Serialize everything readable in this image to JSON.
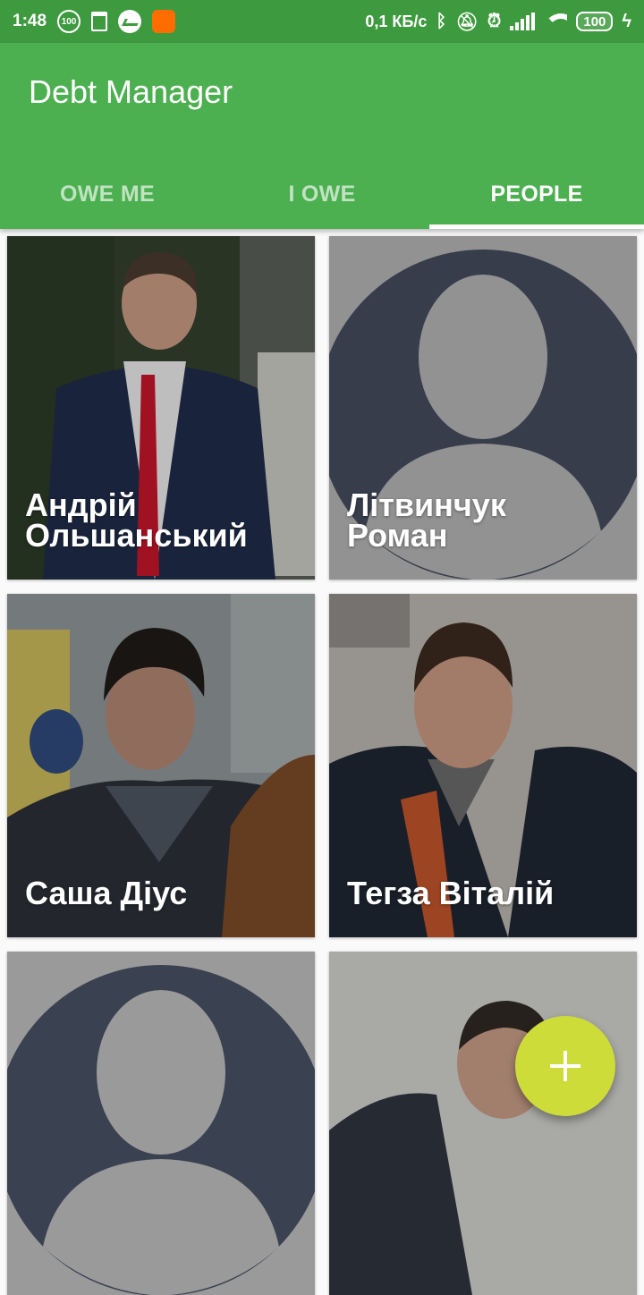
{
  "status_bar": {
    "time": "1:48",
    "notif_badge": "100",
    "network_speed": "0,1 КБ/с",
    "battery": "100",
    "icons": [
      "notification-100-icon",
      "trash-icon",
      "messenger-icon",
      "app-icon",
      "bluetooth-icon",
      "mute-icon",
      "alarm-icon",
      "signal-icon",
      "wifi-icon",
      "battery-icon",
      "charging-icon"
    ]
  },
  "app": {
    "title": "Debt Manager",
    "primary_color": "#4caf50",
    "accent_color": "#cddc39"
  },
  "tabs": [
    {
      "label": "OWE ME",
      "active": false
    },
    {
      "label": "I OWE",
      "active": false
    },
    {
      "label": "PEOPLE",
      "active": true
    }
  ],
  "people": [
    {
      "name_line1": "Андрій",
      "name_line2": "Ольшанський",
      "image": "photo"
    },
    {
      "name_line1": "Літвинчук",
      "name_line2": "Роман",
      "image": "default-avatar"
    },
    {
      "name_line1": "Саша Діус",
      "name_line2": "",
      "image": "photo"
    },
    {
      "name_line1": "Тегза Віталій",
      "name_line2": "",
      "image": "photo"
    },
    {
      "name_line1": "",
      "name_line2": "",
      "image": "default-avatar"
    },
    {
      "name_line1": "",
      "name_line2": "",
      "image": "photo"
    }
  ],
  "fab": {
    "icon": "plus-icon"
  }
}
